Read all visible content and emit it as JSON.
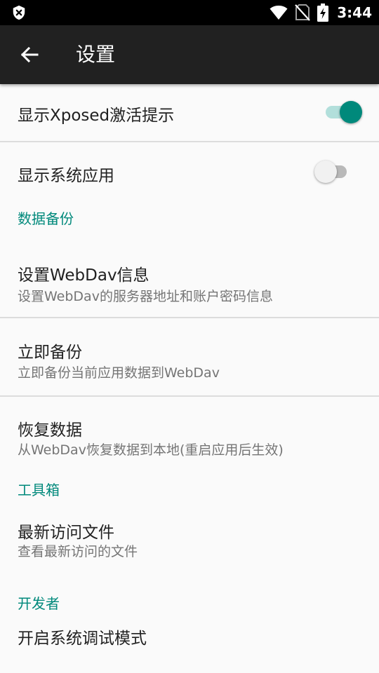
{
  "status_bar": {
    "time": "3:44",
    "icons": [
      "shield-x-icon",
      "wifi-icon",
      "no-sim-icon",
      "battery-charging-icon"
    ]
  },
  "app_bar": {
    "back_icon": "arrow-back-icon",
    "title": "设置"
  },
  "settings": {
    "show_xposed": {
      "title": "显示Xposed激活提示",
      "enabled": true
    },
    "show_system_apps": {
      "title": "显示系统应用",
      "enabled": false
    },
    "backup_category": "数据备份",
    "webdav_info": {
      "title": "设置WebDav信息",
      "summary": "设置WebDav的服务器地址和账户密码信息"
    },
    "backup_now": {
      "title": "立即备份",
      "summary": "立即备份当前应用数据到WebDav"
    },
    "restore": {
      "title": "恢复数据",
      "summary": "从WebDav恢复数据到本地(重启应用后生效)"
    },
    "toolbox_category": "工具箱",
    "recent_files": {
      "title": "最新访问文件",
      "summary": "查看最新访问的文件"
    },
    "developer_category": "开发者",
    "debug_mode": {
      "title": "开启系统调试模式"
    }
  },
  "colors": {
    "accent": "#00897b",
    "app_bar": "#212121",
    "status_bar": "#000000",
    "background": "#fafafa"
  }
}
